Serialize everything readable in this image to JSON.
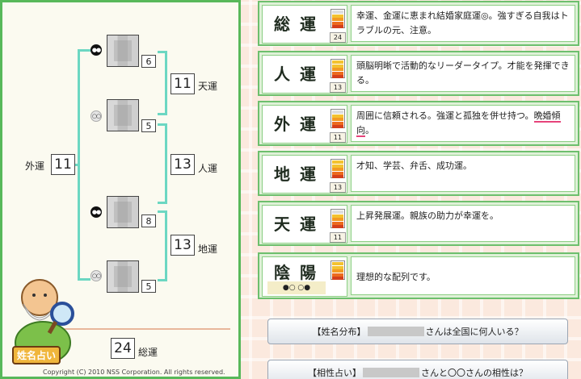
{
  "left_panel": {
    "outer_label": "外運",
    "outer_value": "11",
    "heaven_label": "天運",
    "heaven_value": "11",
    "person_label": "人運",
    "person_value": "13",
    "earth_label": "地運",
    "earth_value": "13",
    "total_label": "総運",
    "total_value": "24",
    "strokes": [
      "6",
      "5",
      "8",
      "5"
    ],
    "faces": [
      "●●",
      "○○",
      "●●",
      "○○"
    ],
    "logo_text": "姓名占い",
    "copyright": "Copyright (C) 2010 NSS Corporation. All rights reserved."
  },
  "fortunes": [
    {
      "title": "総運",
      "level": 3,
      "number": "24",
      "desc": "幸運、金運に恵まれ結婚家庭運◎。強すぎる自我はトラブルの元、注意。"
    },
    {
      "title": "人運",
      "level": 4,
      "number": "13",
      "desc": "頭脳明晰で活動的なリーダータイプ。才能を発揮できる。"
    },
    {
      "title": "外運",
      "level": 3,
      "number": "11",
      "desc_before": "周囲に信頼される。強運と孤独を併せ持つ。",
      "desc_highlight": "晩婚傾向",
      "desc_after": "。"
    },
    {
      "title": "地運",
      "level": 4,
      "number": "13",
      "desc": "才知、学芸、弁舌、成功運。"
    },
    {
      "title": "天運",
      "level": 3,
      "number": "11",
      "desc": "上昇発展運。親族の助力が幸運を。"
    },
    {
      "title": "陰陽",
      "level": 4,
      "faces": "●○ ○●",
      "desc": "理想的な配列です。"
    }
  ],
  "links": [
    {
      "prefix": "【姓名分布】",
      "suffix": "さんは全国に何人いる？"
    },
    {
      "prefix": "【相性占い】",
      "suffix": "さんと〇〇さんの相性は？"
    }
  ]
}
